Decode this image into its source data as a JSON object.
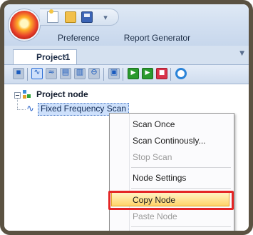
{
  "ribbon": {
    "menu_tabs": [
      "Preference",
      "Report Generator"
    ]
  },
  "document_tab": {
    "label": "Project1",
    "close_glyph": "×"
  },
  "toolbar": {
    "icons": [
      "project-icon",
      "waveform-icon",
      "multi-wave-icon",
      "sweep-icon",
      "spectrum-icon",
      "compare-icon",
      "report-icon",
      "play-icon",
      "step-icon",
      "stop-icon",
      "settings-ring-icon"
    ]
  },
  "tree": {
    "root_label": "Project node",
    "child_label": "Fixed Frequency Scan"
  },
  "context_menu": {
    "items": [
      {
        "label": "Scan Once",
        "enabled": true
      },
      {
        "label": "Scan Continously...",
        "enabled": true
      },
      {
        "label": "Stop Scan",
        "enabled": false
      },
      {
        "label": "Node Settings",
        "enabled": true
      },
      {
        "label": "Copy Node",
        "enabled": true,
        "highlighted": true
      },
      {
        "label": "Paste Node",
        "enabled": false
      }
    ]
  },
  "colors": {
    "frame": "#5b5242",
    "ribbon": "#d3e0f1",
    "selection": "#cde0fb",
    "hover": "#ffd46a",
    "callout": "#e42626"
  }
}
